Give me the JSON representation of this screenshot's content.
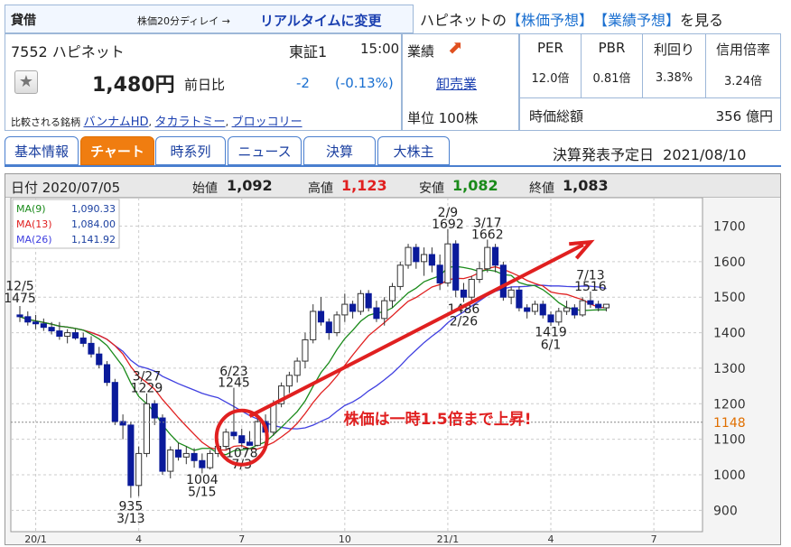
{
  "header": {
    "badge": "貸借",
    "delay_note": "株価20分ディレイ →",
    "realtime_link": "リアルタイムに変更",
    "forecast_prefix": "ハピネットの",
    "stock_forecast": "【株価予想】",
    "earnings_forecast": "【業績予想】",
    "forecast_suffix": "を見る"
  },
  "stock": {
    "code_name": "7552 ハピネット",
    "market": "東証1",
    "time": "15:00",
    "price": "1,480円",
    "change_label": "前日比",
    "change": "-2",
    "change_pct": "(-0.13%)",
    "compare_label": "比較される銘柄",
    "peers": [
      "バンナムHD",
      "タカラトミー",
      "ブロッコリー"
    ]
  },
  "business": {
    "label": "業績",
    "sector": "卸売業",
    "unit": "単位 100株"
  },
  "metrics": {
    "headers": [
      "PER",
      "PBR",
      "利回り",
      "信用倍率"
    ],
    "values": [
      "12.0倍",
      "0.81倍",
      "3.38%",
      "3.24倍"
    ],
    "market_cap_label": "時価総額",
    "market_cap": "356 億円"
  },
  "tabs": [
    "基本情報",
    "チャート",
    "時系列",
    "ニュース",
    "決算",
    "大株主"
  ],
  "active_tab": "チャート",
  "earnings_date": "決算発表予定日  2021/08/10",
  "ohlc": {
    "date": "日付 2020/07/05",
    "open_label": "始値",
    "open": "1,092",
    "high_label": "高値",
    "high": "1,123",
    "low_label": "安値",
    "low": "1,082",
    "close_label": "終値",
    "close": "1,083"
  },
  "colors": {
    "up_bar": "#0a1a9a",
    "ma9": "#1a8a1a",
    "ma13": "#e02020",
    "ma26": "#4040e0",
    "annotation": "#e02020",
    "current": "#e06f00"
  },
  "chart_data": {
    "type": "candlestick",
    "legend": [
      {
        "name": "MA(9)",
        "value": "1,090.33"
      },
      {
        "name": "MA(13)",
        "value": "1,084.00"
      },
      {
        "name": "MA(26)",
        "value": "1,141.92"
      }
    ],
    "y_ticks": [
      900,
      1000,
      1100,
      1200,
      1300,
      1400,
      1500,
      1600,
      1700
    ],
    "ylim": [
      840,
      1780
    ],
    "current_price": "1148",
    "x_ticks": [
      {
        "label": "20/1",
        "week": 2
      },
      {
        "label": "4",
        "week": 15
      },
      {
        "label": "7",
        "week": 28
      },
      {
        "label": "10",
        "week": 41
      },
      {
        "label": "21/1",
        "week": 54
      },
      {
        "label": "4",
        "week": 67
      },
      {
        "label": "7",
        "week": 80
      }
    ],
    "weeks": 85,
    "candles": [
      {
        "w": 0,
        "o": 1450,
        "h": 1475,
        "l": 1430,
        "c": 1445
      },
      {
        "w": 1,
        "o": 1445,
        "h": 1460,
        "l": 1420,
        "c": 1430
      },
      {
        "w": 2,
        "o": 1430,
        "h": 1450,
        "l": 1410,
        "c": 1425
      },
      {
        "w": 3,
        "o": 1425,
        "h": 1440,
        "l": 1405,
        "c": 1415
      },
      {
        "w": 4,
        "o": 1415,
        "h": 1430,
        "l": 1395,
        "c": 1405
      },
      {
        "w": 5,
        "o": 1405,
        "h": 1430,
        "l": 1380,
        "c": 1390
      },
      {
        "w": 6,
        "o": 1390,
        "h": 1410,
        "l": 1370,
        "c": 1400
      },
      {
        "w": 7,
        "o": 1400,
        "h": 1410,
        "l": 1380,
        "c": 1385
      },
      {
        "w": 8,
        "o": 1385,
        "h": 1400,
        "l": 1360,
        "c": 1370
      },
      {
        "w": 9,
        "o": 1370,
        "h": 1390,
        "l": 1330,
        "c": 1340
      },
      {
        "w": 10,
        "o": 1340,
        "h": 1360,
        "l": 1300,
        "c": 1310
      },
      {
        "w": 11,
        "o": 1310,
        "h": 1320,
        "l": 1250,
        "c": 1260
      },
      {
        "w": 12,
        "o": 1260,
        "h": 1270,
        "l": 1140,
        "c": 1150
      },
      {
        "w": 13,
        "o": 1150,
        "h": 1170,
        "l": 1100,
        "c": 1140
      },
      {
        "w": 14,
        "o": 1140,
        "h": 1150,
        "l": 935,
        "c": 970
      },
      {
        "w": 15,
        "o": 970,
        "h": 1080,
        "l": 940,
        "c": 1060
      },
      {
        "w": 16,
        "o": 1060,
        "h": 1229,
        "l": 1050,
        "c": 1200
      },
      {
        "w": 17,
        "o": 1200,
        "h": 1210,
        "l": 1140,
        "c": 1160
      },
      {
        "w": 18,
        "o": 1160,
        "h": 1170,
        "l": 1000,
        "c": 1010
      },
      {
        "w": 19,
        "o": 1010,
        "h": 1080,
        "l": 990,
        "c": 1070
      },
      {
        "w": 20,
        "o": 1070,
        "h": 1090,
        "l": 1040,
        "c": 1050
      },
      {
        "w": 21,
        "o": 1050,
        "h": 1080,
        "l": 1030,
        "c": 1060
      },
      {
        "w": 22,
        "o": 1060,
        "h": 1075,
        "l": 1020,
        "c": 1040
      },
      {
        "w": 23,
        "o": 1040,
        "h": 1060,
        "l": 1004,
        "c": 1020
      },
      {
        "w": 24,
        "o": 1020,
        "h": 1070,
        "l": 1015,
        "c": 1060
      },
      {
        "w": 25,
        "o": 1060,
        "h": 1090,
        "l": 1050,
        "c": 1080
      },
      {
        "w": 26,
        "o": 1080,
        "h": 1130,
        "l": 1070,
        "c": 1120
      },
      {
        "w": 27,
        "o": 1120,
        "h": 1245,
        "l": 1100,
        "c": 1110
      },
      {
        "w": 28,
        "o": 1110,
        "h": 1130,
        "l": 1078,
        "c": 1090
      },
      {
        "w": 29,
        "o": 1092,
        "h": 1123,
        "l": 1082,
        "c": 1083
      },
      {
        "w": 30,
        "o": 1083,
        "h": 1160,
        "l": 1080,
        "c": 1150
      },
      {
        "w": 31,
        "o": 1150,
        "h": 1170,
        "l": 1110,
        "c": 1120
      },
      {
        "w": 32,
        "o": 1120,
        "h": 1210,
        "l": 1110,
        "c": 1200
      },
      {
        "w": 33,
        "o": 1200,
        "h": 1260,
        "l": 1190,
        "c": 1250
      },
      {
        "w": 34,
        "o": 1250,
        "h": 1290,
        "l": 1230,
        "c": 1280
      },
      {
        "w": 35,
        "o": 1280,
        "h": 1330,
        "l": 1260,
        "c": 1320
      },
      {
        "w": 36,
        "o": 1320,
        "h": 1400,
        "l": 1300,
        "c": 1380
      },
      {
        "w": 37,
        "o": 1380,
        "h": 1480,
        "l": 1370,
        "c": 1460
      },
      {
        "w": 38,
        "o": 1460,
        "h": 1500,
        "l": 1420,
        "c": 1430
      },
      {
        "w": 39,
        "o": 1430,
        "h": 1440,
        "l": 1380,
        "c": 1400
      },
      {
        "w": 40,
        "o": 1400,
        "h": 1460,
        "l": 1390,
        "c": 1450
      },
      {
        "w": 41,
        "o": 1450,
        "h": 1510,
        "l": 1430,
        "c": 1480
      },
      {
        "w": 42,
        "o": 1480,
        "h": 1490,
        "l": 1440,
        "c": 1460
      },
      {
        "w": 43,
        "o": 1460,
        "h": 1520,
        "l": 1450,
        "c": 1510
      },
      {
        "w": 44,
        "o": 1510,
        "h": 1520,
        "l": 1460,
        "c": 1470
      },
      {
        "w": 45,
        "o": 1470,
        "h": 1490,
        "l": 1430,
        "c": 1440
      },
      {
        "w": 46,
        "o": 1440,
        "h": 1500,
        "l": 1420,
        "c": 1490
      },
      {
        "w": 47,
        "o": 1490,
        "h": 1540,
        "l": 1470,
        "c": 1530
      },
      {
        "w": 48,
        "o": 1530,
        "h": 1600,
        "l": 1520,
        "c": 1590
      },
      {
        "w": 49,
        "o": 1590,
        "h": 1650,
        "l": 1580,
        "c": 1640
      },
      {
        "w": 50,
        "o": 1640,
        "h": 1650,
        "l": 1580,
        "c": 1600
      },
      {
        "w": 51,
        "o": 1600,
        "h": 1640,
        "l": 1560,
        "c": 1620
      },
      {
        "w": 52,
        "o": 1620,
        "h": 1640,
        "l": 1570,
        "c": 1590
      },
      {
        "w": 53,
        "o": 1590,
        "h": 1620,
        "l": 1520,
        "c": 1540
      },
      {
        "w": 54,
        "o": 1540,
        "h": 1692,
        "l": 1530,
        "c": 1650
      },
      {
        "w": 55,
        "o": 1650,
        "h": 1660,
        "l": 1500,
        "c": 1520
      },
      {
        "w": 56,
        "o": 1520,
        "h": 1540,
        "l": 1486,
        "c": 1500
      },
      {
        "w": 57,
        "o": 1500,
        "h": 1560,
        "l": 1490,
        "c": 1550
      },
      {
        "w": 58,
        "o": 1550,
        "h": 1600,
        "l": 1540,
        "c": 1580
      },
      {
        "w": 59,
        "o": 1580,
        "h": 1662,
        "l": 1570,
        "c": 1640
      },
      {
        "w": 60,
        "o": 1640,
        "h": 1650,
        "l": 1570,
        "c": 1590
      },
      {
        "w": 61,
        "o": 1590,
        "h": 1600,
        "l": 1490,
        "c": 1500
      },
      {
        "w": 62,
        "o": 1500,
        "h": 1530,
        "l": 1480,
        "c": 1520
      },
      {
        "w": 63,
        "o": 1520,
        "h": 1530,
        "l": 1460,
        "c": 1470
      },
      {
        "w": 64,
        "o": 1470,
        "h": 1480,
        "l": 1440,
        "c": 1460
      },
      {
        "w": 65,
        "o": 1460,
        "h": 1490,
        "l": 1450,
        "c": 1480
      },
      {
        "w": 66,
        "o": 1480,
        "h": 1490,
        "l": 1440,
        "c": 1450
      },
      {
        "w": 67,
        "o": 1450,
        "h": 1460,
        "l": 1419,
        "c": 1430
      },
      {
        "w": 68,
        "o": 1430,
        "h": 1470,
        "l": 1420,
        "c": 1460
      },
      {
        "w": 69,
        "o": 1460,
        "h": 1490,
        "l": 1450,
        "c": 1470
      },
      {
        "w": 70,
        "o": 1470,
        "h": 1480,
        "l": 1440,
        "c": 1450
      },
      {
        "w": 71,
        "o": 1450,
        "h": 1500,
        "l": 1445,
        "c": 1490
      },
      {
        "w": 72,
        "o": 1490,
        "h": 1516,
        "l": 1470,
        "c": 1480
      },
      {
        "w": 73,
        "o": 1480,
        "h": 1490,
        "l": 1460,
        "c": 1470
      },
      {
        "w": 74,
        "o": 1470,
        "h": 1480,
        "l": 1460,
        "c": 1480
      }
    ],
    "annotations": [
      {
        "text": "12/5",
        "w": 0,
        "v": 1520
      },
      {
        "text": "1475",
        "w": 0,
        "v": 1485
      },
      {
        "text": "3/27",
        "w": 16,
        "v": 1265
      },
      {
        "text": "1229",
        "w": 16,
        "v": 1232
      },
      {
        "text": "935",
        "w": 14,
        "v": 900
      },
      {
        "text": "3/13",
        "w": 14,
        "v": 865
      },
      {
        "text": "1004",
        "w": 23,
        "v": 975
      },
      {
        "text": "5/15",
        "w": 23,
        "v": 940
      },
      {
        "text": "6/23",
        "w": 27,
        "v": 1280
      },
      {
        "text": "1245",
        "w": 27,
        "v": 1248
      },
      {
        "text": "1078",
        "w": 28,
        "v": 1050
      },
      {
        "text": "7/3",
        "w": 28,
        "v": 1018
      },
      {
        "text": "2/9",
        "w": 54,
        "v": 1727
      },
      {
        "text": "1692",
        "w": 54,
        "v": 1694
      },
      {
        "text": "3/17",
        "w": 59,
        "v": 1697
      },
      {
        "text": "1662",
        "w": 59,
        "v": 1664
      },
      {
        "text": "1486",
        "w": 56,
        "v": 1455
      },
      {
        "text": "2/26",
        "w": 56,
        "v": 1420
      },
      {
        "text": "1419",
        "w": 67,
        "v": 1390
      },
      {
        "text": "6/1",
        "w": 67,
        "v": 1355
      },
      {
        "text": "7/13",
        "w": 72,
        "v": 1550
      },
      {
        "text": "1516",
        "w": 72,
        "v": 1518
      }
    ],
    "trend_arrow": {
      "from": {
        "w": 29,
        "v": 1165
      },
      "to": {
        "w": 72,
        "v": 1655
      }
    },
    "callout": {
      "text": "株価は一時1.5倍まで上昇!",
      "w": 42,
      "v": 1148
    },
    "highlight_circle": {
      "w": 28,
      "v": 1105
    }
  }
}
